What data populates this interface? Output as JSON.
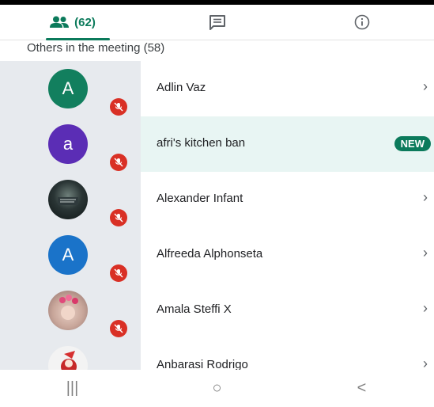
{
  "tabs": {
    "people_count": "(62)",
    "chat_icon": "chat-icon",
    "info_icon": "info-icon"
  },
  "section_title": "Others in the meeting (58)",
  "participants": [
    {
      "name": "Adlin Vaz",
      "avatar_letter": "A",
      "avatar_color": "#127f5e"
    },
    {
      "name": "afri's kitchen ban",
      "avatar_letter": "a",
      "avatar_color": "#5b2db5",
      "badge": "NEW"
    },
    {
      "name": "Alexander Infant",
      "avatar_letter": "",
      "avatar_color": "#1e2a2a"
    },
    {
      "name": "Alfreeda Alphonseta",
      "avatar_letter": "A",
      "avatar_color": "#1a73c9"
    },
    {
      "name": "Amala Steffi X",
      "avatar_letter": "",
      "avatar_color": "#c9a79b"
    },
    {
      "name": "Anbarasi Rodrigo",
      "avatar_letter": "",
      "avatar_color": "#f3f3f3"
    }
  ],
  "chevron": "›",
  "nav": {
    "recents": "|||",
    "home": "○",
    "back": "<"
  },
  "colors": {
    "accent": "#0b7a5b",
    "mute": "#d93025",
    "highlight": "#e8f5f3"
  }
}
